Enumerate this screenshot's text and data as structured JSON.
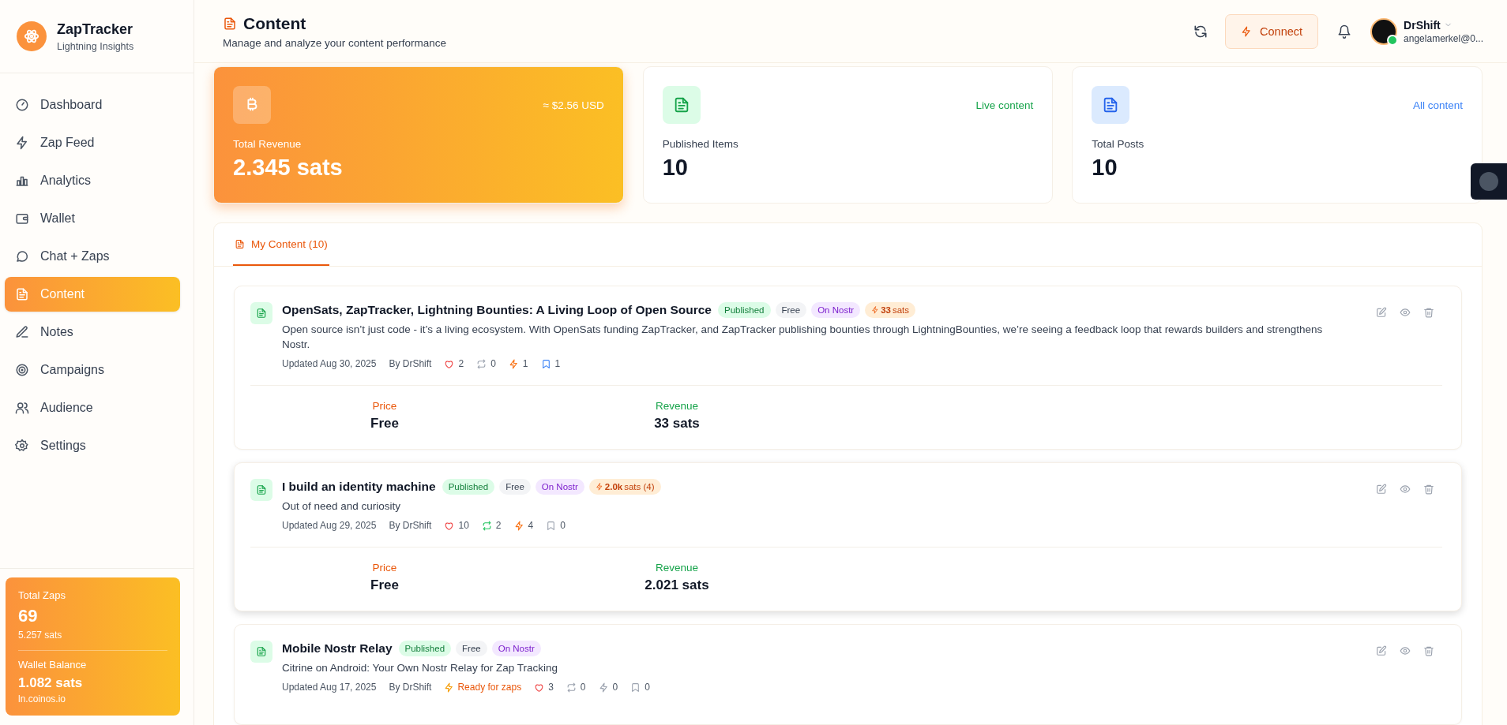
{
  "brand": {
    "name": "ZapTracker",
    "tagline": "Lightning Insights"
  },
  "sidebar": {
    "nav": [
      {
        "label": "Dashboard",
        "selected": false
      },
      {
        "label": "Zap Feed",
        "selected": false
      },
      {
        "label": "Analytics",
        "selected": false
      },
      {
        "label": "Wallet",
        "selected": false
      },
      {
        "label": "Chat + Zaps",
        "selected": false
      },
      {
        "label": "Content",
        "selected": true
      },
      {
        "label": "Notes",
        "selected": false
      },
      {
        "label": "Campaigns",
        "selected": false
      },
      {
        "label": "Audience",
        "selected": false
      },
      {
        "label": "Settings",
        "selected": false
      }
    ],
    "summary": {
      "total_zaps_label": "Total Zaps",
      "total_zaps": "69",
      "total_zaps_sats": "5.257 sats",
      "wallet_label": "Wallet Balance",
      "wallet_balance": "1.082 sats",
      "wallet_host": "ln.coinos.io"
    }
  },
  "header": {
    "title": "Content",
    "subtitle": "Manage and analyze your content performance",
    "connect_label": "Connect",
    "user": {
      "name": "DrShift",
      "email": "angelamerkel@0...",
      "online": true
    }
  },
  "stats": [
    {
      "kind": "revenue",
      "label": "Total Revenue",
      "value": "2.345 sats",
      "note": "≈ $2.56 USD"
    },
    {
      "kind": "published",
      "label": "Published Items",
      "value": "10",
      "note": "Live content"
    },
    {
      "kind": "posts",
      "label": "Total Posts",
      "value": "10",
      "note": "All content"
    }
  ],
  "tabs": [
    {
      "label": "My Content (10)",
      "selected": true
    }
  ],
  "content_items": [
    {
      "title": "OpenSats, ZapTracker, Lightning Bounties: A Living Loop of Open Source",
      "highlighted": false,
      "badges": [
        {
          "kind": "status",
          "text": "Published"
        },
        {
          "kind": "price",
          "text": "Free"
        },
        {
          "kind": "network",
          "text": "On Nostr"
        },
        {
          "kind": "zaps",
          "text": "**33** sats"
        }
      ],
      "description": "Open source isn’t just code - it’s a living ecosystem. With OpenSats funding ZapTracker, and ZapTracker publishing bounties through LightningBounties, we’re seeing a feedback loop that rewards builders and strengthens Nostr.",
      "updated": "Updated Aug 30, 2025",
      "author": "By DrShift",
      "stats": [
        {
          "kind": "likes",
          "value": "2",
          "active": true
        },
        {
          "kind": "reposts",
          "value": "0",
          "active": false
        },
        {
          "kind": "zaps",
          "value": "1",
          "active": true
        },
        {
          "kind": "bookmarks",
          "value": "1",
          "active": true
        }
      ],
      "price_label": "Price",
      "price": "Free",
      "revenue_label": "Revenue",
      "revenue": "33 sats"
    },
    {
      "title": "I build an identity machine",
      "highlighted": true,
      "badges": [
        {
          "kind": "status",
          "text": "Published"
        },
        {
          "kind": "price",
          "text": "Free"
        },
        {
          "kind": "network",
          "text": "On Nostr"
        },
        {
          "kind": "zaps",
          "text": "**2.0k** sats (4)"
        }
      ],
      "description": "Out of need and curiosity",
      "updated": "Updated Aug 29, 2025",
      "author": "By DrShift",
      "stats": [
        {
          "kind": "likes",
          "value": "10",
          "active": true
        },
        {
          "kind": "reposts",
          "value": "2",
          "active": true
        },
        {
          "kind": "zaps",
          "value": "4",
          "active": true
        },
        {
          "kind": "bookmarks",
          "value": "0",
          "active": false
        }
      ],
      "price_label": "Price",
      "price": "Free",
      "revenue_label": "Revenue",
      "revenue": "2.021 sats"
    },
    {
      "title": "Mobile Nostr Relay",
      "highlighted": false,
      "badges": [
        {
          "kind": "status",
          "text": "Published"
        },
        {
          "kind": "price",
          "text": "Free"
        },
        {
          "kind": "network",
          "text": "On Nostr"
        }
      ],
      "description": "Citrine on Android: Your Own Nostr Relay for Zap Tracking",
      "updated": "Updated Aug 17, 2025",
      "author": "By DrShift",
      "ready": "Ready for zaps",
      "stats": [
        {
          "kind": "likes",
          "value": "3",
          "active": true
        },
        {
          "kind": "reposts",
          "value": "0",
          "active": false
        },
        {
          "kind": "zaps",
          "value": "0",
          "active": false
        },
        {
          "kind": "bookmarks",
          "value": "0",
          "active": false
        }
      ]
    }
  ]
}
